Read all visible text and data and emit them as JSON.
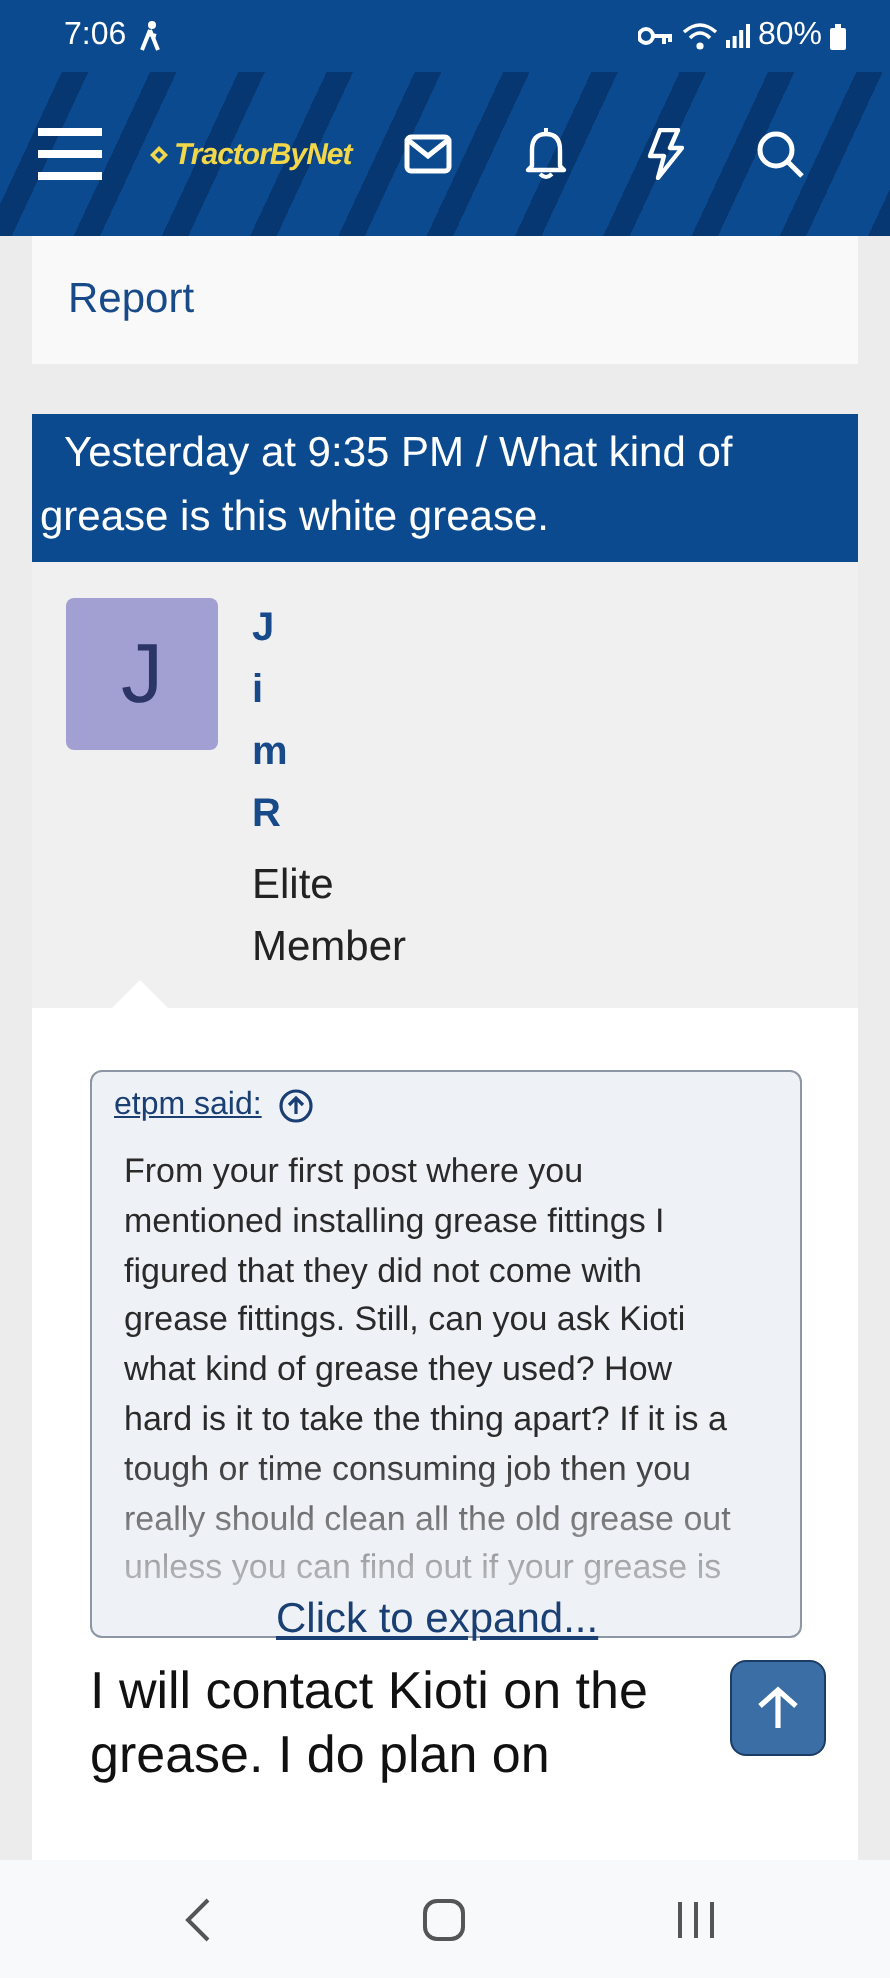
{
  "status_bar": {
    "time": "7:06",
    "battery": "80%"
  },
  "header": {
    "logo": "TractorByNet"
  },
  "report_link": "Report",
  "post": {
    "banner": "Yesterday at 9:35 PM / What kind of grease is this white grease.",
    "avatar_letter": "J",
    "author_letters": [
      "J",
      "i",
      "m",
      "R"
    ],
    "user_title": "Elite Member",
    "quote": {
      "author": "etpm said:",
      "text": "From your first post where you mentioned installing grease fittings I figured that they did not come with grease fittings. Still, can you ask Kioti what kind of grease they used? How hard is it to take the thing apart? If it is a tough or time consuming job then you really should clean all the old grease out unless you can find out if your grease is",
      "expand": "Click to expand..."
    },
    "body": "I will contact Kioti on the grease. I do plan on"
  }
}
